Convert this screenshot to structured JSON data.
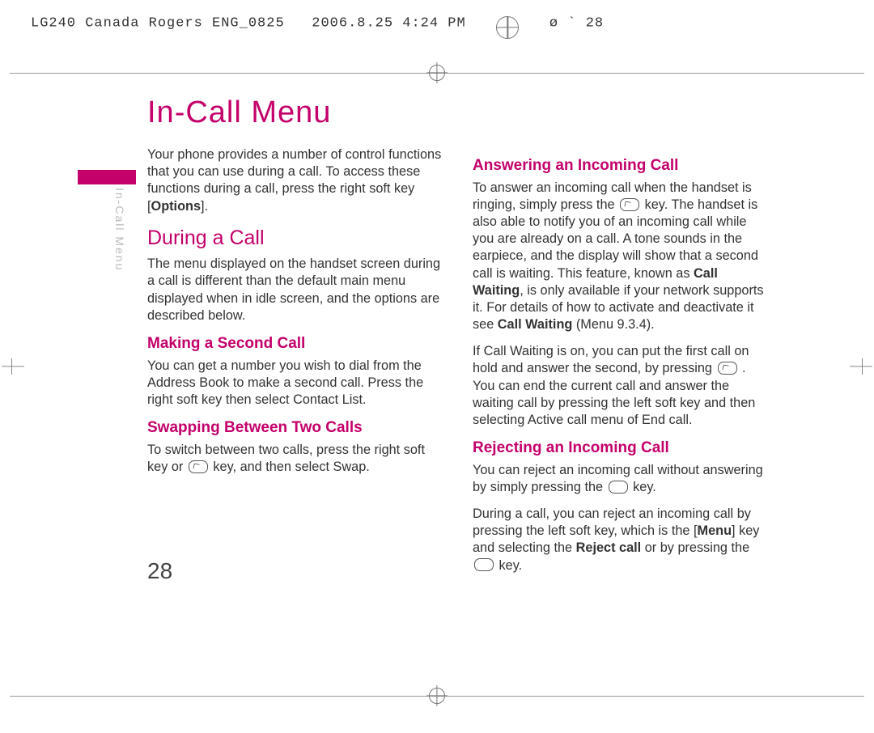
{
  "prepress": {
    "doc_id": "LG240 Canada Rogers ENG_0825",
    "timestamp": "2006.8.25 4:24 PM",
    "tail": "ø   `  28"
  },
  "sidebar": {
    "label": "In-Call Menu"
  },
  "title": "In-Call Menu",
  "page_number": "28",
  "left": {
    "intro_a": "Your phone provides a number of control functions that you can use during a call. To access these functions during a call, press the right soft key [",
    "intro_options": "Options",
    "intro_b": "].",
    "h2_during": "During a Call",
    "during_p": "The menu displayed on the handset screen during a call is different than the default main menu displayed when in idle screen, and the options are described below.",
    "h3_second": "Making a Second Call",
    "second_p": "You can get a number you wish to dial from the Address Book to make a second call. Press the right soft key then select Contact List.",
    "h3_swap": "Swapping Between Two Calls",
    "swap_p_a": "To switch between two calls, press the right soft key or ",
    "swap_p_b": " key, and then select Swap."
  },
  "right": {
    "h3_answer": "Answering an Incoming Call",
    "answer_p1_a": "To answer an incoming call when the handset is ringing, simply press the ",
    "answer_p1_b": " key. The handset is also able to notify you of an incoming call while you are already on a call. A tone sounds in the earpiece, and the display will show that a second call is waiting. This feature, known as ",
    "answer_cw": "Call Waiting",
    "answer_p1_c": ", is only available if your network supports it. For details of how to activate and deactivate it see ",
    "answer_cw2": "Call Waiting",
    "answer_p1_d": " (Menu 9.3.4).",
    "answer_p2_a": "If Call Waiting is on, you can put the first call on hold and answer the second, by pressing ",
    "answer_p2_b": " . You can end the current call and answer the waiting call by pressing the left soft key and then selecting Active call menu of End call.",
    "h3_reject": "Rejecting an Incoming Call",
    "reject_p1_a": "You can reject an incoming call without answering by simply pressing the ",
    "reject_p1_b": " key.",
    "reject_p2_a": "During a call, you can reject an incoming call by pressing the left soft key, which is the [",
    "reject_menu": "Menu",
    "reject_p2_b": "] key and selecting the ",
    "reject_rc": "Reject call",
    "reject_p2_c": " or by pressing the ",
    "reject_p2_d": " key."
  }
}
